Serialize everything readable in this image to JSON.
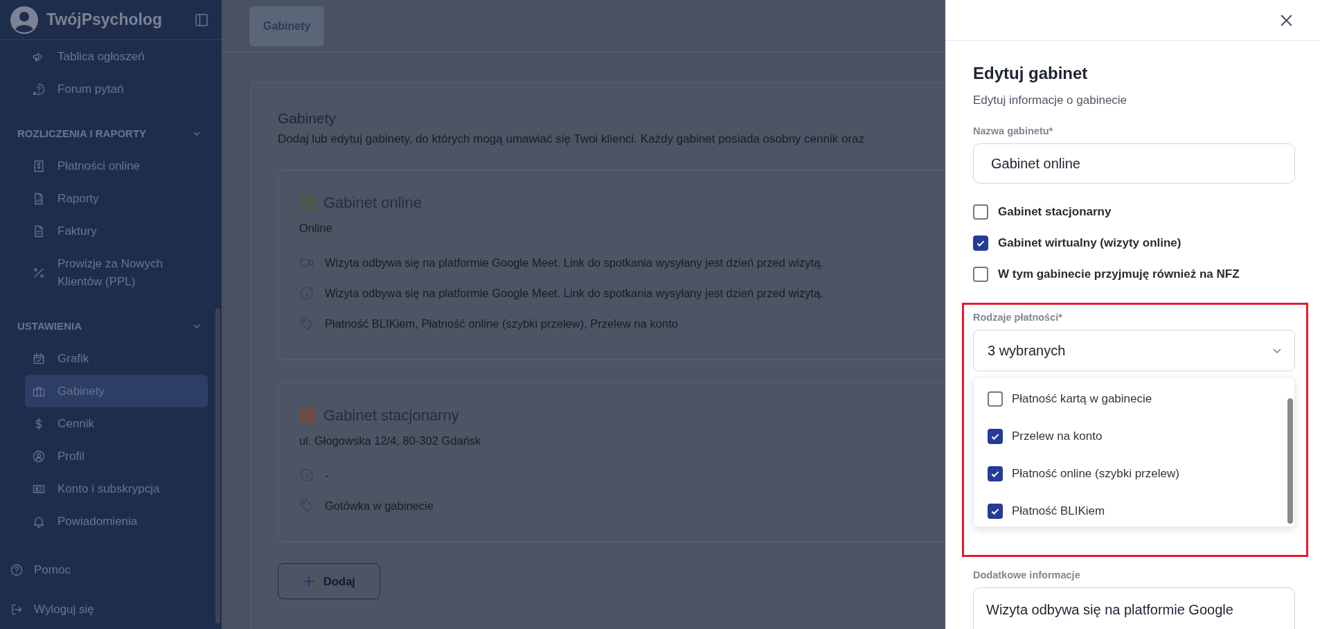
{
  "sidebar": {
    "brand": "TwójPsycholog",
    "top_items": [
      {
        "label": "Tablica ogłoszeń",
        "selected": false
      },
      {
        "label": "Forum pytań",
        "selected": false
      }
    ],
    "sections": [
      {
        "heading": "ROZLICZENIA I RAPORTY",
        "expanded": true,
        "items": [
          {
            "label": "Płatności online",
            "selected": false
          },
          {
            "label": "Raporty",
            "selected": false
          },
          {
            "label": "Faktury",
            "selected": false
          },
          {
            "label": "Prowizje za Nowych Klientów (PPL)",
            "selected": false
          }
        ]
      },
      {
        "heading": "USTAWIENIA",
        "expanded": true,
        "items": [
          {
            "label": "Grafik",
            "selected": false
          },
          {
            "label": "Gabinety",
            "selected": true
          },
          {
            "label": "Cennik",
            "selected": false
          },
          {
            "label": "Profil",
            "selected": false
          },
          {
            "label": "Konto i subskrypcja",
            "selected": false
          },
          {
            "label": "Powiadomienia",
            "selected": false
          }
        ]
      }
    ],
    "footer_items": [
      {
        "label": "Pomoc"
      },
      {
        "label": "Wyloguj się"
      }
    ]
  },
  "tabs": [
    {
      "label": "Gabinety",
      "selected": true
    }
  ],
  "main": {
    "title": "Gabinety",
    "description": "Dodaj lub edytuj gabinety, do których mogą umawiać się Twoi klienci. Każdy gabinet posiada osobny cennik oraz",
    "offices": [
      {
        "name": "Gabinet online",
        "color": "#4a594e",
        "subtitle": "Online",
        "details": [
          {
            "kind": "video",
            "text": "Wizyta odbywa się na platformie Google Meet. Link do spotkania wysyłany jest dzień przed wizytą."
          },
          {
            "kind": "info",
            "text": "Wizyta odbywa się na platformie Google Meet. Link do spotkania wysyłany jest dzień przed wizytą."
          },
          {
            "kind": "tag",
            "text": "Płatność BLIKiem,  Płatność online (szybki przelew),  Przelew na konto"
          }
        ]
      },
      {
        "name": "Gabinet stacjonarny",
        "color": "#6a4d45",
        "subtitle": "ul. Głogowska 12/4, 80-302 Gdańsk",
        "details": [
          {
            "kind": "info",
            "text": "-"
          },
          {
            "kind": "tag",
            "text": "Gotówka w gabinecie"
          }
        ]
      }
    ],
    "add_button": "Dodaj"
  },
  "panel": {
    "title": "Edytuj gabinet",
    "subtitle": "Edytuj informacje o gabinecie",
    "name_field": {
      "label": "Nazwa gabinetu*",
      "value": "Gabinet online"
    },
    "options": [
      {
        "label": "Gabinet stacjonarny",
        "checked": false
      },
      {
        "label": "Gabinet wirtualny (wizyty online)",
        "checked": true
      },
      {
        "label": "W tym gabinecie przyjmuję również na NFZ",
        "checked": false
      }
    ],
    "payment": {
      "label": "Rodzaje płatności*",
      "value": "3 wybranych",
      "expanded": true,
      "options": [
        {
          "label": "Płatność kartą w gabinecie",
          "checked": false
        },
        {
          "label": "Przelew na konto",
          "checked": true
        },
        {
          "label": "Płatność online (szybki przelew)",
          "checked": true
        },
        {
          "label": "Płatność BLIKiem",
          "checked": true
        }
      ]
    },
    "notes": {
      "label": "Dodatkowe informacje",
      "value": "Wizyta odbywa się na platformie Google"
    }
  }
}
